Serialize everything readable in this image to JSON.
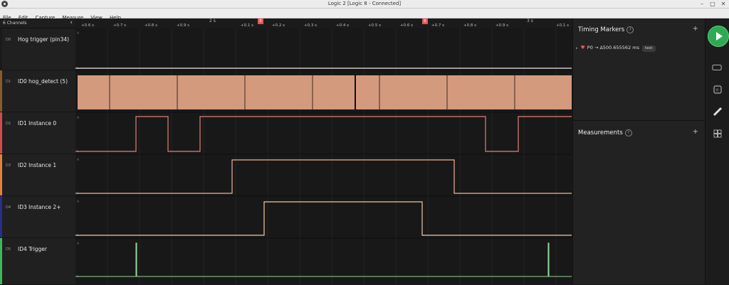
{
  "window": {
    "title": "Logic 2 [Logic 8 - Connected]"
  },
  "menu": [
    "File",
    "Edit",
    "Capture",
    "Measure",
    "View",
    "Help"
  ],
  "channels_header": {
    "label": "6 Channels"
  },
  "channels": [
    {
      "num": "D0",
      "name": "Hog trigger (pin34)",
      "color": "#1a1a1a"
    },
    {
      "num": "D1",
      "name": "ID0 hog_detect (5)",
      "color": "#8a5a2a"
    },
    {
      "num": "D2",
      "name": "ID1 Instance 0",
      "color": "#d24a4a"
    },
    {
      "num": "D3",
      "name": "ID2 Instance 1",
      "color": "#e0823c"
    },
    {
      "num": "D4",
      "name": "ID3 Instance 2+",
      "color": "#2c2c8a"
    },
    {
      "num": "D5",
      "name": "ID4 Trigger",
      "color": "#3cb85a"
    }
  ],
  "ruler": {
    "ticks": [
      "+0.6 s",
      "+0.7 s",
      "+0.8 s",
      "+0.9 s",
      "+0.1 s",
      "+0.2 s",
      "+0.3 s",
      "+0.4 s",
      "+0.5 s",
      "+0.6 s",
      "+0.7 s",
      "+0.8 s",
      "+0.9 s",
      "+0.1 s"
    ],
    "major": [
      "2 s",
      "3 s"
    ],
    "markers": [
      "0",
      "0"
    ]
  },
  "timing_markers": {
    "title": "Timing Markers",
    "help": "?",
    "add": "+",
    "entry": {
      "name": "P0",
      "arrow": "→",
      "value": "Δ500.655562 ms",
      "tag": "test"
    }
  },
  "measurements": {
    "title": "Measurements",
    "help": "?",
    "add": "+"
  },
  "sidebar": {
    "icons": [
      "play-icon",
      "analyzer-icon",
      "extensions-icon",
      "measure-ruler-icon",
      "layout-icon"
    ]
  }
}
